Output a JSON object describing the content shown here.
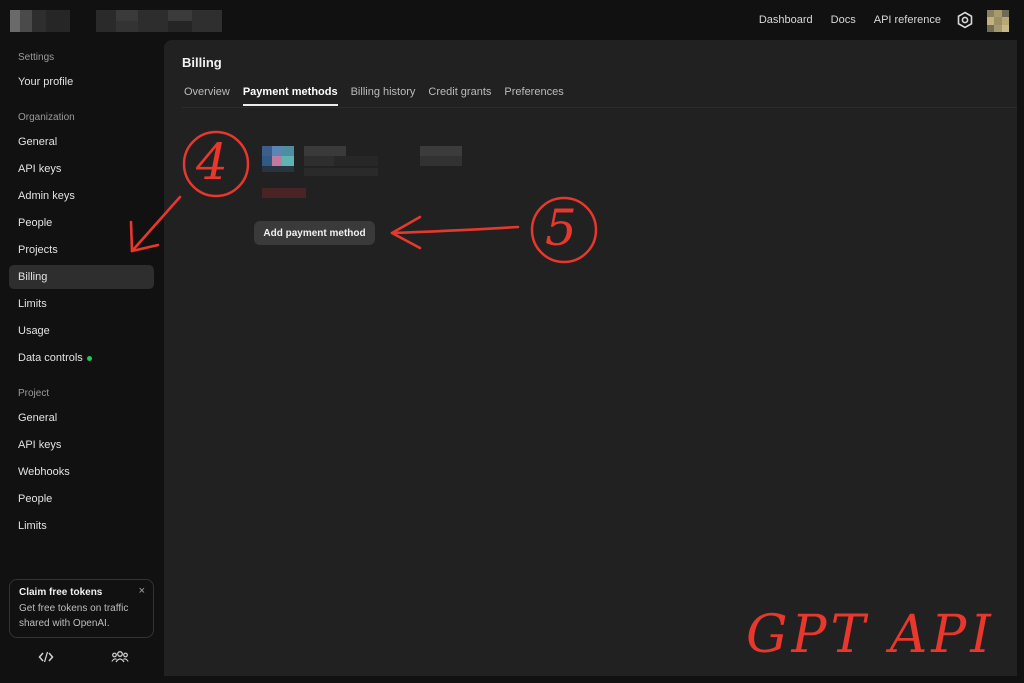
{
  "header": {
    "nav": [
      "Dashboard",
      "Docs",
      "API reference"
    ],
    "settings_icon": "gear-icon",
    "avatar_icon": "avatar"
  },
  "sidebar": {
    "settings_heading": "Settings",
    "your_profile": "Your profile",
    "organization_heading": "Organization",
    "org_items": [
      "General",
      "API keys",
      "Admin keys",
      "People",
      "Projects",
      "Billing",
      "Limits",
      "Usage",
      "Data controls"
    ],
    "active_item": "Billing",
    "project_heading": "Project",
    "project_items": [
      "General",
      "API keys",
      "Webhooks",
      "People",
      "Limits"
    ],
    "claim": {
      "title": "Claim free tokens",
      "text": "Get free tokens on traffic shared with OpenAI.",
      "close": "×"
    },
    "bottom_icons": [
      "code-icon",
      "team-icon"
    ]
  },
  "main": {
    "title": "Billing",
    "tabs": [
      "Overview",
      "Payment methods",
      "Billing history",
      "Credit grants",
      "Preferences"
    ],
    "active_tab": "Payment methods",
    "add_button": "Add payment method"
  },
  "annotations": {
    "step4": "4",
    "step5": "5",
    "watermark": "GPT API"
  },
  "colors": {
    "accent_annotation": "#e8372c",
    "status_dot": "#22c55e",
    "active_bg": "#2e2e2e",
    "panel_bg": "#212121"
  }
}
